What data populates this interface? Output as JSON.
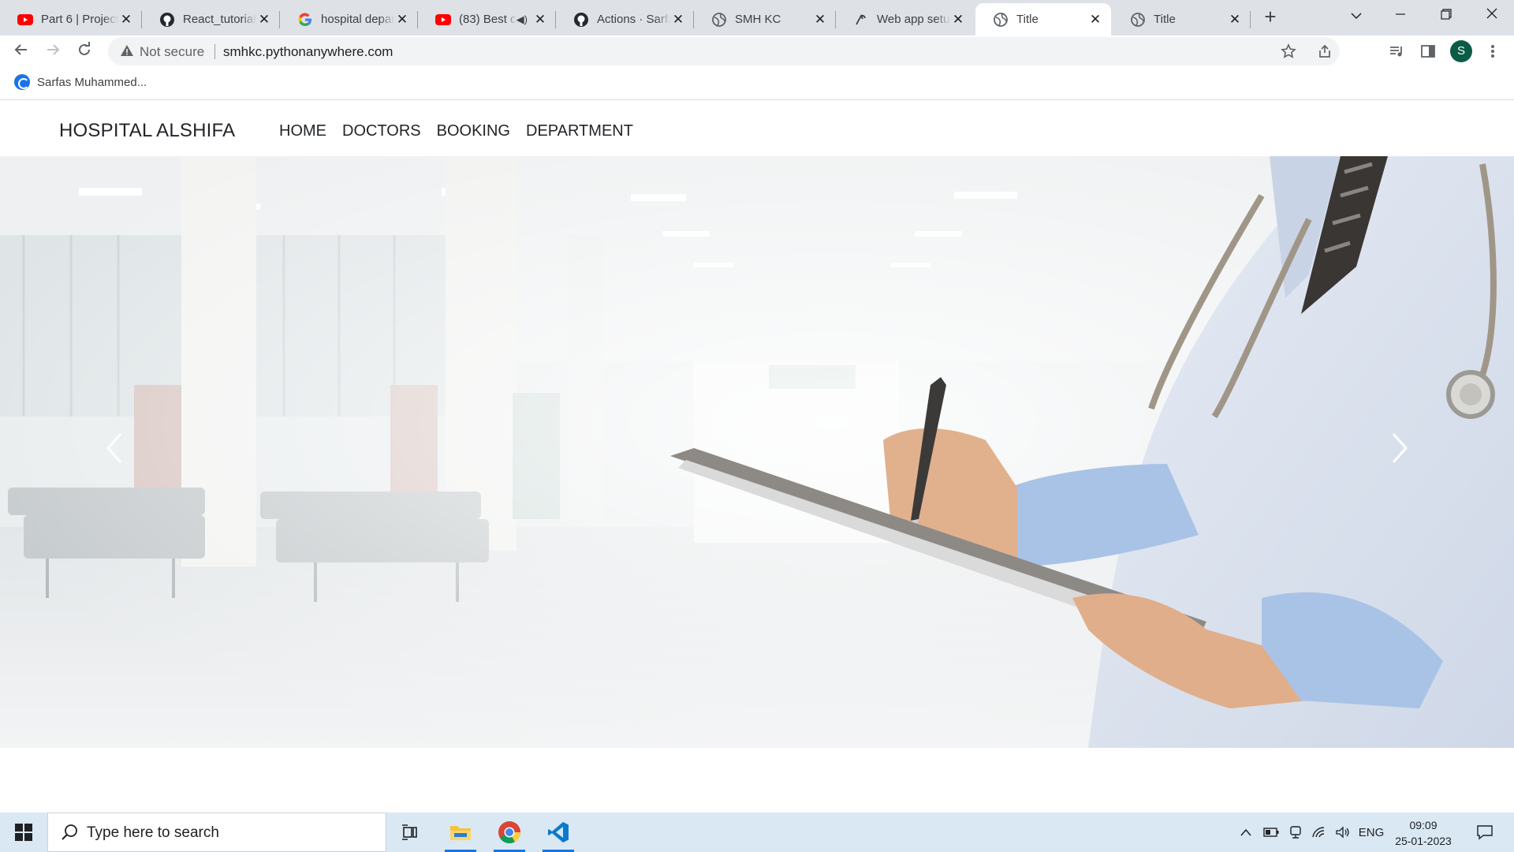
{
  "browser": {
    "tabs": [
      {
        "title": "Part 6 | Project",
        "icon": "youtube-icon"
      },
      {
        "title": "React_tutorial",
        "icon": "github-icon"
      },
      {
        "title": "hospital depar",
        "icon": "google-icon"
      },
      {
        "title": "(83) Best c",
        "icon": "youtube-icon"
      },
      {
        "title": "Actions · Sarfa",
        "icon": "github-icon"
      },
      {
        "title": "SMH KC",
        "icon": "globe-icon"
      },
      {
        "title": "Web app setu",
        "icon": "pythonanywhere-icon"
      },
      {
        "title": "Title",
        "icon": "globe-icon",
        "active": true
      },
      {
        "title": "Title",
        "icon": "globe-icon"
      }
    ],
    "address": {
      "security_label": "Not secure",
      "url": "smhkc.pythonanywhere.com"
    },
    "profile_initial": "S",
    "bookmarks": [
      {
        "label": "Sarfas Muhammed..."
      }
    ]
  },
  "site": {
    "brand": "HOSPITAL ALSHIFA",
    "nav": [
      "HOME",
      "DOCTORS",
      "BOOKING",
      "DEPARTMENT"
    ]
  },
  "taskbar": {
    "search_placeholder": "Type here to search",
    "language": "ENG",
    "time": "09:09",
    "date": "25-01-2023"
  },
  "colors": {
    "tabstrip": "#dee1e6",
    "taskbar": "#d9e8f3",
    "profile": "#0b5c47"
  }
}
